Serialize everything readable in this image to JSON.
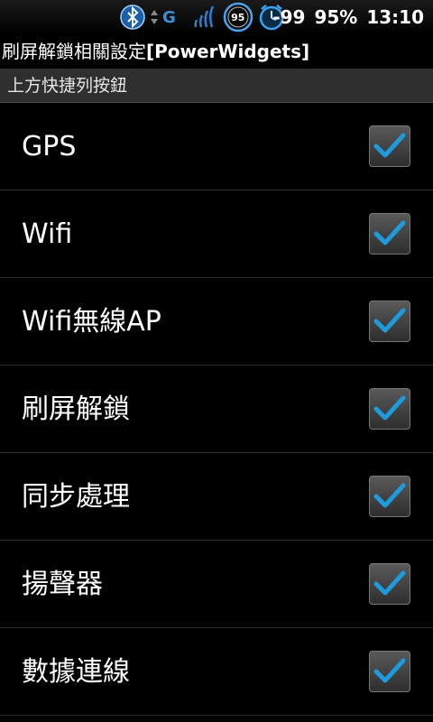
{
  "status_bar": {
    "network": "G",
    "battery_badge": "95",
    "signal_dbm": "-99",
    "battery_percent": "95%",
    "time": "13:10"
  },
  "title_bar": {
    "title_prefix": "刷屏解鎖相關設定",
    "title_app": "[PowerWidgets]"
  },
  "category": {
    "label": "上方快捷列按鈕"
  },
  "preferences": [
    {
      "label": "GPS",
      "checked": true
    },
    {
      "label": "Wifi",
      "checked": true
    },
    {
      "label": "Wifi無線AP",
      "checked": true
    },
    {
      "label": "刷屏解鎖",
      "checked": true
    },
    {
      "label": "同步處理",
      "checked": true
    },
    {
      "label": "揚聲器",
      "checked": true
    },
    {
      "label": "數據連線",
      "checked": true
    }
  ],
  "icons": {
    "bluetooth": "bluetooth-icon",
    "data_arrows": "data-arrows-icon",
    "signal": "signal-icon",
    "battery_badge": "battery-badge-icon",
    "alarm": "alarm-icon",
    "checkmark": "checkmark-icon"
  },
  "colors": {
    "accent_blue": "#1e9bdc",
    "category_bg": "#2f2f2f",
    "background": "#000000"
  }
}
